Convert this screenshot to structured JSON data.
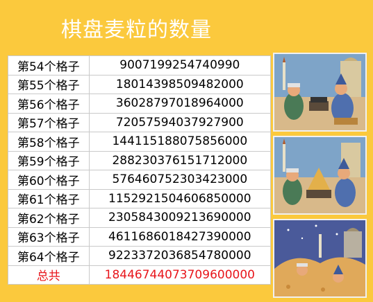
{
  "title": "棋盘麦粒的数量",
  "rows": [
    {
      "label": "第54个格子",
      "value": "9007199254740990"
    },
    {
      "label": "第55个格子",
      "value": "18014398509482000"
    },
    {
      "label": "第56个格子",
      "value": "36028797018964000"
    },
    {
      "label": "第57个格子",
      "value": "72057594037927900"
    },
    {
      "label": "第58个格子",
      "value": "144115188075856000"
    },
    {
      "label": "第59个格子",
      "value": "288230376151712000"
    },
    {
      "label": "第60个格子",
      "value": "576460752303423000"
    },
    {
      "label": "第61个格子",
      "value": "1152921504606850000"
    },
    {
      "label": "第62个格子",
      "value": "2305843009213690000"
    },
    {
      "label": "第63个格子",
      "value": "4611686018427390000"
    },
    {
      "label": "第64个格子",
      "value": "9223372036854780000"
    }
  ],
  "total": {
    "label": "总共",
    "value": "18446744073709600000"
  },
  "colors": {
    "background": "#fbc93d",
    "title": "#ffffff",
    "total_text": "#e8151b"
  },
  "illustrations": [
    "king-and-sage-chessboard-cartoon",
    "wheat-pile-on-chessboard-cartoon",
    "buried-in-wheat-cartoon"
  ]
}
